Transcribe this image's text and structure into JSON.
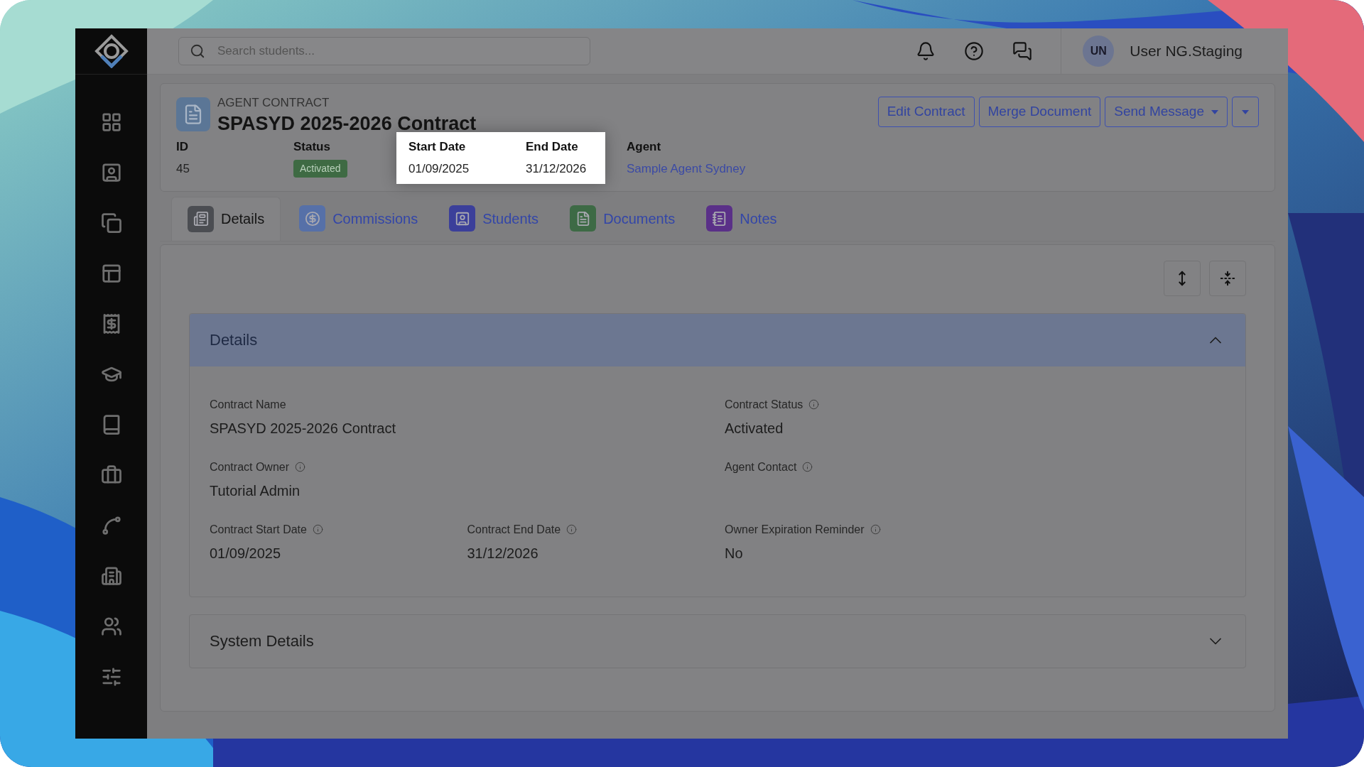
{
  "search": {
    "placeholder": "Search students..."
  },
  "user": {
    "initials": "UN",
    "name": "User NG.Staging"
  },
  "record": {
    "type_label": "AGENT CONTRACT",
    "title": "SPASYD 2025-2026 Contract"
  },
  "actions": [
    {
      "kind": "button",
      "label": "Edit Contract"
    },
    {
      "kind": "button",
      "label": "Merge Document"
    },
    {
      "kind": "dropdown",
      "label": "Send Message"
    },
    {
      "kind": "caret"
    }
  ],
  "summary_groups": [
    {
      "highlighted": false,
      "items": [
        {
          "label": "ID",
          "value": "45",
          "kind": "text"
        },
        {
          "label": "Status",
          "value": "Activated",
          "kind": "badge"
        }
      ]
    },
    {
      "highlighted": true,
      "items": [
        {
          "label": "Start Date",
          "value": "01/09/2025",
          "kind": "text"
        },
        {
          "label": "End Date",
          "value": "31/12/2026",
          "kind": "text"
        }
      ]
    },
    {
      "highlighted": false,
      "items": [
        {
          "label": "Agent",
          "value": "Sample Agent Sydney",
          "kind": "link"
        }
      ]
    }
  ],
  "tabs": [
    {
      "label": "Details",
      "selected": true,
      "color": "#4b4d52"
    },
    {
      "label": "Commissions",
      "selected": false,
      "color": "#5670a8"
    },
    {
      "label": "Students",
      "selected": false,
      "color": "#3b3f9a"
    },
    {
      "label": "Documents",
      "selected": false,
      "color": "#3d6a45"
    },
    {
      "label": "Notes",
      "selected": false,
      "color": "#5a3088"
    }
  ],
  "sections": [
    {
      "title": "Details",
      "expanded": true,
      "rows": [
        [
          {
            "label": "Contract Name",
            "value": "SPASYD 2025-2026 Contract",
            "info": false
          },
          {
            "label": "Contract Status",
            "value": "Activated",
            "info": true
          }
        ],
        [
          {
            "label": "Contract Owner",
            "value": "Tutorial Admin",
            "info": true
          },
          {
            "label": "Agent Contact",
            "info": true
          }
        ],
        [
          {
            "label": "Contract Start Date",
            "value": "01/09/2025",
            "info": true
          },
          {
            "label": "Contract End Date",
            "value": "31/12/2026",
            "info": true
          },
          {
            "label": "Owner Expiration Reminder",
            "value": "No",
            "info": true
          }
        ]
      ]
    },
    {
      "title": "System Details",
      "expanded": false
    }
  ]
}
